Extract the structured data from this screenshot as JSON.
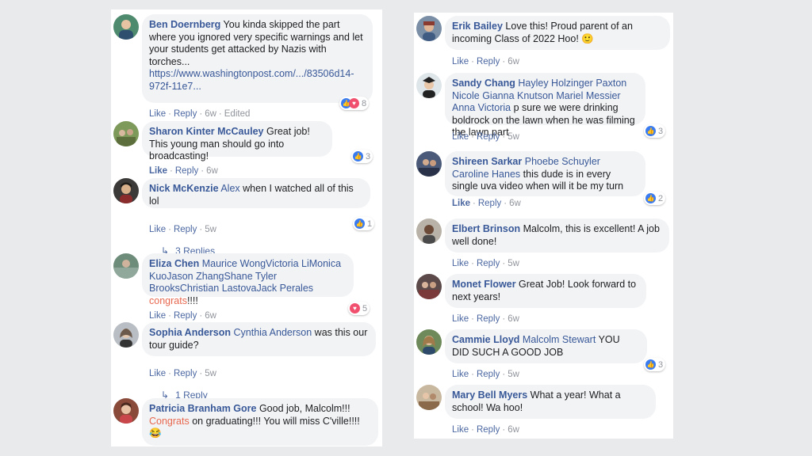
{
  "left": [
    {
      "author": "Ben Doernberg",
      "pre_text": "You kinda skipped the part where you ignored very specific warnings and let your students get attacked by Nazis with torches...",
      "link": "https://www.washingtonpost.com/.../83506d14-972f-11e7...",
      "actions": {
        "like": "Like",
        "reply": "Reply",
        "time": "6w",
        "edited": "Edited"
      },
      "reaction": "8"
    },
    {
      "author": "Sharon Kinter McCauley",
      "text": "Great job! This young man should go into broadcasting!",
      "actions": {
        "like": "Like",
        "reply": "Reply",
        "time": "6w"
      },
      "reaction": "3"
    },
    {
      "author": "Nick McKenzie",
      "tag": "Alex",
      "text": "when I watched all of this lol",
      "actions": {
        "like": "Like",
        "reply": "Reply",
        "time": "5w"
      },
      "reaction": "1",
      "replies": "3 Replies"
    },
    {
      "author": "Eliza Chen",
      "tag": "Maurice WongVictoria LiMonica KuoJason ZhangShane Tyler BrooksChristian LastovaJack Perales",
      "red": "congrats",
      "text": "!!!!",
      "actions": {
        "like": "Like",
        "reply": "Reply",
        "time": "6w"
      },
      "reaction": "5"
    },
    {
      "author": "Sophia Anderson",
      "tag": "Cynthia Anderson",
      "text": "was this our tour guide?",
      "actions": {
        "like": "Like",
        "reply": "Reply",
        "time": "5w"
      },
      "replies": "1 Reply"
    },
    {
      "author": "Patricia Branham Gore",
      "text": "Good job, Malcolm!!!",
      "red": "Congrats",
      "text2": "on graduating!!! You will miss C'ville!!!!",
      "emoji": "😂"
    }
  ],
  "right": [
    {
      "author": "Erik Bailey",
      "text": "Love this! Proud parent of an incoming Class of 2022 Hoo!",
      "emoji": "🙂",
      "actions": {
        "like": "Like",
        "reply": "Reply",
        "time": "6w"
      }
    },
    {
      "author": "Sandy Chang",
      "tag": "Hayley Holzinger Paxton Nicole Gianna Knutson Mariel Messier Anna Victoria",
      "text": "p sure we were drinking boldrock on the lawn when he was filming the lawn part",
      "actions": {
        "like": "Like",
        "reply": "Reply",
        "time": "5w"
      },
      "reaction": "3"
    },
    {
      "author": "Shireen Sarkar",
      "tag": "Phoebe Schuyler Caroline Hanes",
      "text": "this dude is in every single uva video when will it be my turn",
      "actions": {
        "like": "Like",
        "reply": "Reply",
        "time": "6w"
      },
      "reaction": "2"
    },
    {
      "author": "Elbert Brinson",
      "text": "Malcolm, this is excellent! A job well done!",
      "actions": {
        "like": "Like",
        "reply": "Reply",
        "time": "5w"
      }
    },
    {
      "author": "Monet Flower",
      "text": "Great Job! Look forward to next years!",
      "actions": {
        "like": "Like",
        "reply": "Reply",
        "time": "6w"
      }
    },
    {
      "author": "Cammie Lloyd",
      "tag": "Malcolm Stewart",
      "text": "YOU DID SUCH A GOOD JOB",
      "actions": {
        "like": "Like",
        "reply": "Reply",
        "time": "5w"
      },
      "reaction": "3"
    },
    {
      "author": "Mary Bell Myers",
      "text": "What a year! What a school! Wa hoo!",
      "actions": {
        "like": "Like",
        "reply": "Reply",
        "time": "6w"
      }
    }
  ],
  "icons": {
    "like": "thumbs-up-icon",
    "love": "heart-icon",
    "reply_arrow": "reply-arrow-icon"
  },
  "colors": {
    "link_blue": "#385898",
    "action_blue": "#4b67a1",
    "bubble_bg": "#f2f3f5",
    "like_blue": "#3a7cf0",
    "love_red": "#f0506e",
    "congrats_red": "#e8684f"
  }
}
